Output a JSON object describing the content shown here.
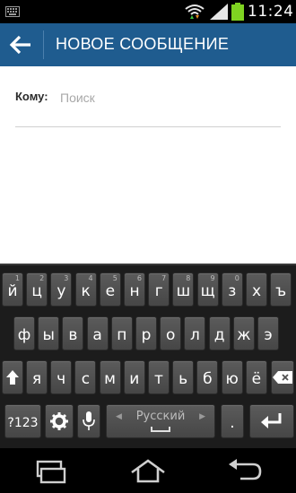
{
  "status_bar": {
    "time": "11:24",
    "icons": [
      "keyboard-notification-icon",
      "wifi-icon",
      "signal-icon",
      "battery-icon"
    ]
  },
  "app_bar": {
    "back_icon": "arrow-left-icon",
    "title": "НОВОЕ СООБЩЕНИЕ"
  },
  "recipient": {
    "label": "Кому:",
    "placeholder": "Поиск",
    "value": ""
  },
  "keyboard": {
    "row1": [
      {
        "char": "й",
        "hint": "1"
      },
      {
        "char": "ц",
        "hint": "2"
      },
      {
        "char": "у",
        "hint": "3"
      },
      {
        "char": "к",
        "hint": "4"
      },
      {
        "char": "е",
        "hint": "5"
      },
      {
        "char": "н",
        "hint": "6"
      },
      {
        "char": "г",
        "hint": "7"
      },
      {
        "char": "ш",
        "hint": "8"
      },
      {
        "char": "щ",
        "hint": "9"
      },
      {
        "char": "з",
        "hint": "0"
      },
      {
        "char": "х",
        "hint": ""
      },
      {
        "char": "ъ",
        "hint": ""
      }
    ],
    "row2": [
      "ф",
      "ы",
      "в",
      "а",
      "п",
      "р",
      "о",
      "л",
      "д",
      "ж",
      "э"
    ],
    "row3": [
      "я",
      "ч",
      "с",
      "м",
      "и",
      "т",
      "ь",
      "б",
      "ю",
      "ё"
    ],
    "numbers_key": "?123",
    "space_language": "Русский",
    "period_key": ".",
    "icons": {
      "shift": "shift-icon",
      "backspace": "backspace-icon",
      "settings": "settings-gear-icon",
      "mic": "microphone-icon",
      "enter": "enter-icon"
    }
  },
  "nav_bar": {
    "icons": [
      "recent-apps-icon",
      "home-icon",
      "back-icon"
    ]
  },
  "colors": {
    "app_bar": "#1f5c8f",
    "keyboard_bg": "#1c1c1c",
    "key": "#505050"
  }
}
